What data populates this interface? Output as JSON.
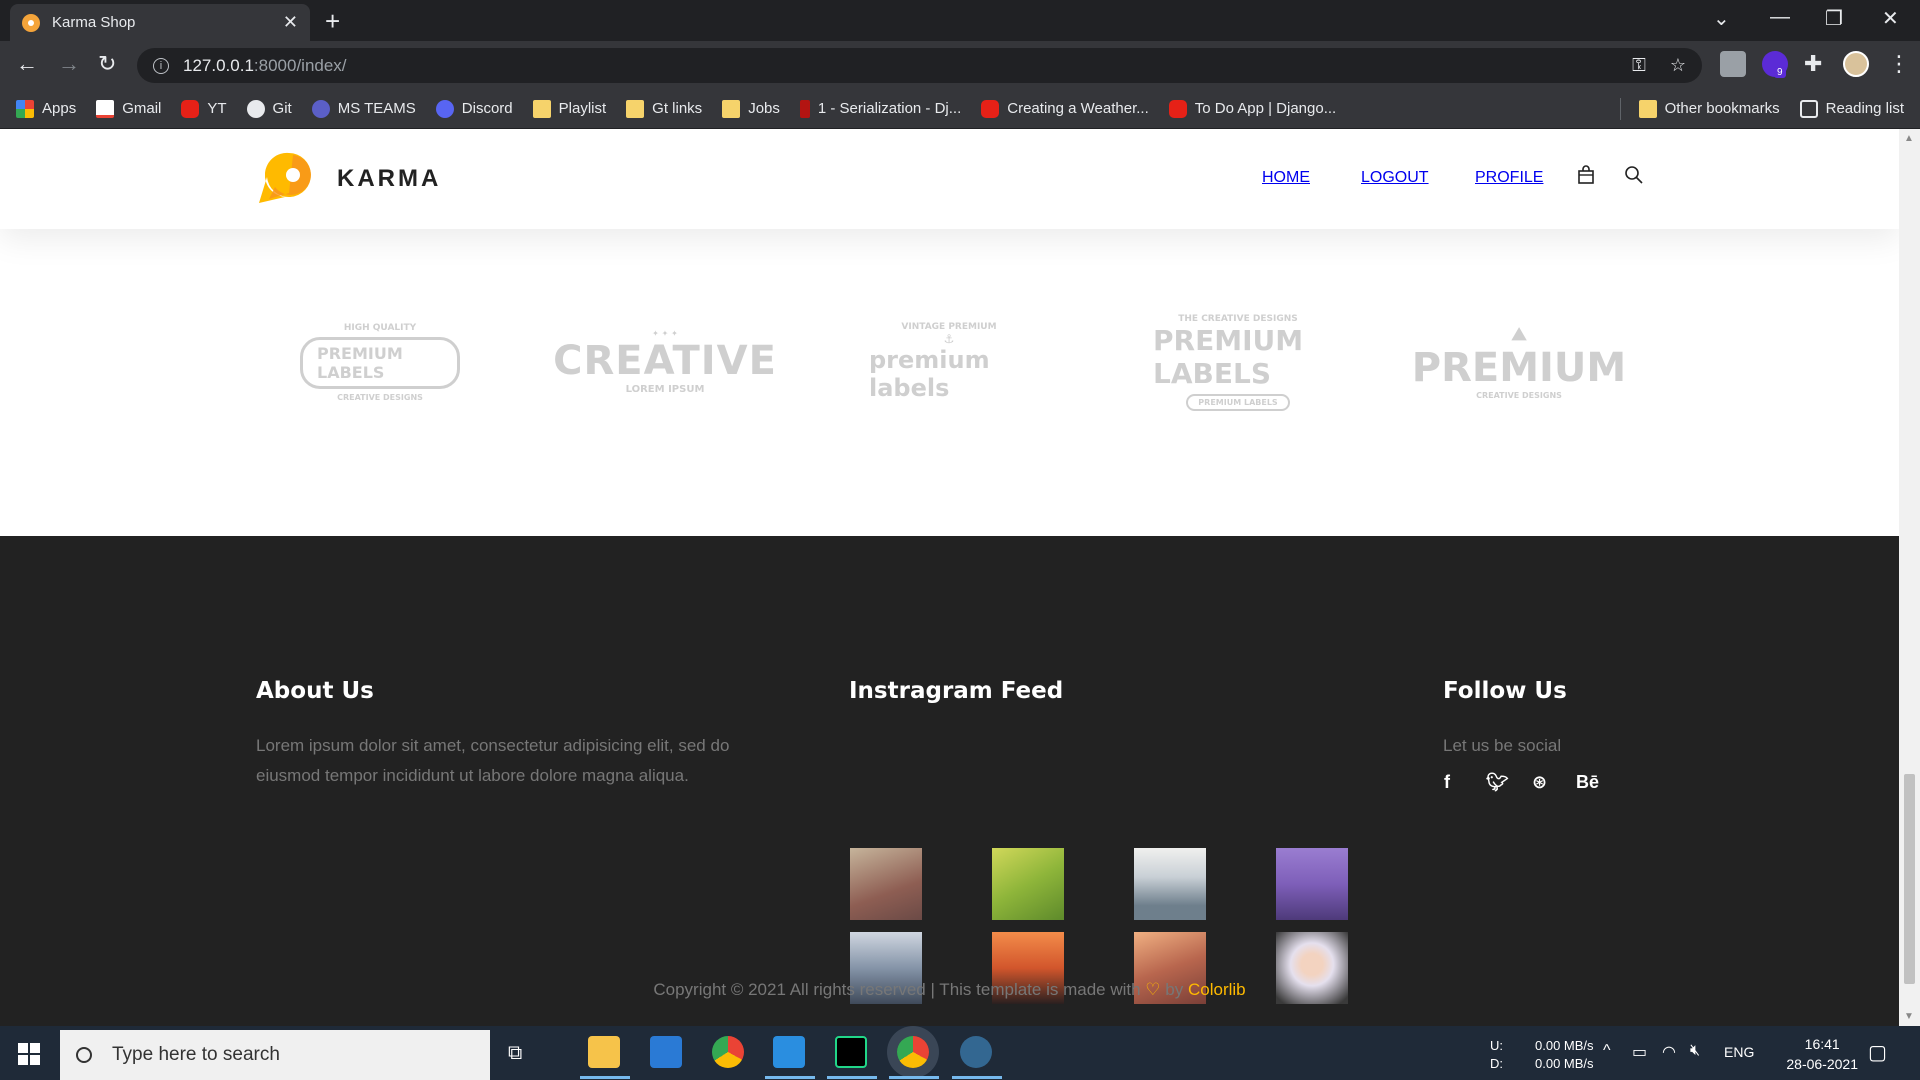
{
  "browser": {
    "tab_title": "Karma Shop",
    "tab_close": "✕",
    "new_tab": "+",
    "url_host": "127.0.0.1",
    "url_path": ":8000/index/",
    "bookmarks": [
      {
        "label": "Apps",
        "icon": "apps"
      },
      {
        "label": "Gmail",
        "icon": "gmail"
      },
      {
        "label": "YT",
        "icon": "yt"
      },
      {
        "label": "Git",
        "icon": "gh"
      },
      {
        "label": "MS TEAMS",
        "icon": "teams"
      },
      {
        "label": "Discord",
        "icon": "discord"
      },
      {
        "label": "Playlist",
        "icon": "folder"
      },
      {
        "label": "Gt links",
        "icon": "folder"
      },
      {
        "label": "Jobs",
        "icon": "folder"
      },
      {
        "label": "1 - Serialization - Dj...",
        "icon": "red"
      },
      {
        "label": "Creating a Weather...",
        "icon": "yt"
      },
      {
        "label": "To Do App | Django...",
        "icon": "yt"
      }
    ],
    "other_bookmarks": "Other bookmarks",
    "reading_list": "Reading list",
    "extension_badge": "9"
  },
  "site": {
    "logo_text": "KARMA",
    "nav": [
      {
        "label": "HOME",
        "active": true
      },
      {
        "label": "LOGOUT",
        "active": false
      },
      {
        "label": "PROFILE",
        "active": false
      }
    ],
    "brands": [
      {
        "top": "HIGH QUALITY",
        "main": "PREMIUM LABELS",
        "sub": "CREATIVE DESIGNS"
      },
      {
        "top": "",
        "main": "CREATIVE",
        "sub": "LOREM IPSUM"
      },
      {
        "top": "VINTAGE PREMIUM",
        "main": "premium labels",
        "sub": ""
      },
      {
        "top": "THE CREATIVE DESIGNS",
        "main": "PREMIUM LABELS",
        "sub": "PREMIUM LABELS"
      },
      {
        "top": "",
        "main": "PREMIUM",
        "sub": "CREATIVE DESIGNS"
      }
    ]
  },
  "footer": {
    "about_title": "About Us",
    "about_text": "Lorem ipsum dolor sit amet, consectetur adipisicing elit, sed do eiusmod tempor incididunt ut labore dolore magna aliqua.",
    "insta_title": "Instragram Feed",
    "follow_title": "Follow Us",
    "follow_text": "Let us be social",
    "social": [
      "f",
      "t",
      "dribbble",
      "Bē"
    ],
    "copyright_prefix": "Copyright © 2021 All rights reserved | This template is made with",
    "copyright_by": "by",
    "copyright_brand": "Colorlib"
  },
  "taskbar": {
    "search_placeholder": "Type here to search",
    "net_up_label": "U:",
    "net_down_label": "D:",
    "net_up": "0.00 MB/s",
    "net_down": "0.00 MB/s",
    "lang": "ENG",
    "time": "16:41",
    "date": "28-06-2021"
  },
  "colors": {
    "accent": "#ffba00",
    "footer_bg": "#222222",
    "chrome_bg": "#35363a"
  }
}
